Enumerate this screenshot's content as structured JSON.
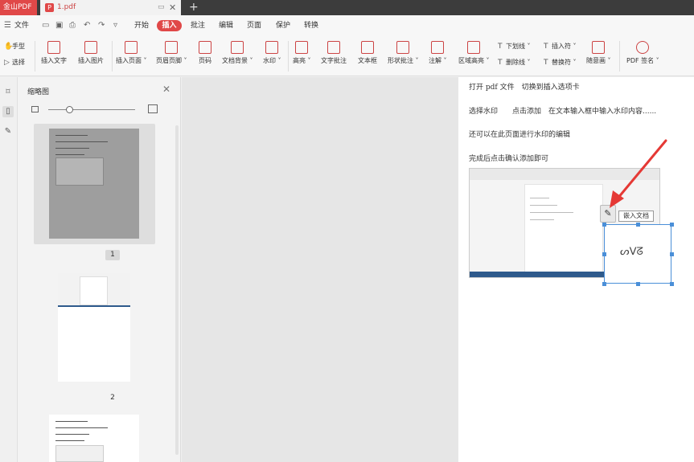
{
  "titlebar": {
    "app_name": "金山PDF",
    "doc_tab": "1.pdf",
    "pdf_icon": "P",
    "new_tab": "+",
    "restore_icon": "restore-icon",
    "close_icon": "close-icon"
  },
  "menu": {
    "file": "文件",
    "tabs": [
      "开始",
      "插入",
      "批注",
      "编辑",
      "页面",
      "保护",
      "转换"
    ],
    "active_tab": "插入"
  },
  "ribbon": {
    "hand_tool": "手型",
    "select_tool": "选择",
    "items": [
      "插入文字",
      "插入图片",
      "插入页面",
      "页眉页脚",
      "页码",
      "文档背景",
      "水印",
      "高亮",
      "文字批注",
      "文本框",
      "形状批注",
      "注解",
      "区域高亮"
    ],
    "small_items": [
      "下划线",
      "删除线",
      "插入符",
      "替换符"
    ],
    "freehand": "随意画",
    "pdf_sign": "PDF 签名"
  },
  "thumbnails": {
    "title": "缩略图",
    "zoom_level": 0.24,
    "pages": [
      "1",
      "2"
    ]
  },
  "document": {
    "lines": [
      "打开 pdf 文件　切换到插入选项卡",
      "选择水印　　点击添加　在文本输入框中输入水印内容......",
      "还可以在此页面进行水印的编辑",
      "完成后点击确认添加即可"
    ],
    "embed_tooltip": "嵌入文档"
  },
  "colors": {
    "accent": "#e04848",
    "arrow": "#e53935",
    "selection": "#4a8fd8"
  }
}
